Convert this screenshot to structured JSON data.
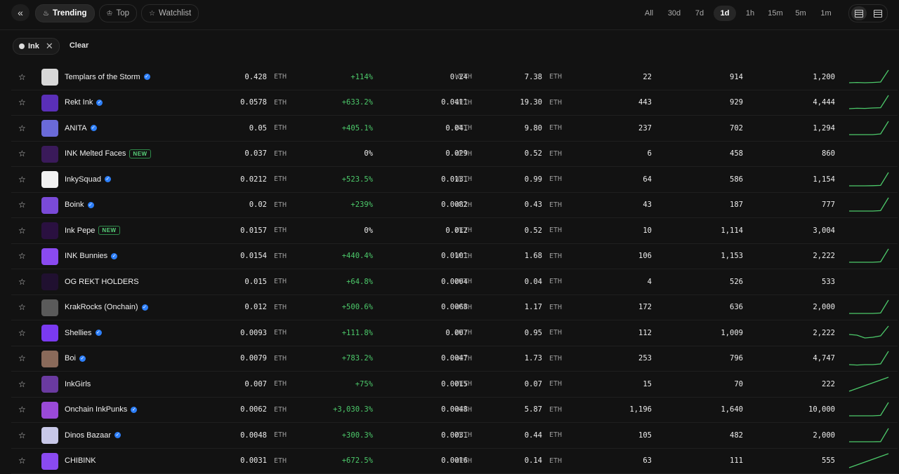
{
  "header": {
    "tabs": [
      {
        "label": "Trending",
        "icon": "flame-icon",
        "active": true
      },
      {
        "label": "Top",
        "icon": "trophy-icon",
        "active": false
      },
      {
        "label": "Watchlist",
        "icon": "star-icon",
        "active": false
      }
    ],
    "ranges": [
      {
        "label": "All",
        "active": false
      },
      {
        "label": "30d",
        "active": false
      },
      {
        "label": "7d",
        "active": false
      },
      {
        "label": "1d",
        "active": true
      },
      {
        "label": "1h",
        "active": false
      },
      {
        "label": "15m",
        "active": false
      },
      {
        "label": "5m",
        "active": false
      },
      {
        "label": "1m",
        "active": false
      }
    ]
  },
  "filters": {
    "chip_label": "Ink",
    "clear_label": "Clear"
  },
  "colors": {
    "positive": "#4cc96a",
    "verified": "#2d7ff9",
    "background": "#121212"
  },
  "rows": [
    {
      "name": "Templars of the Storm",
      "verified": true,
      "new": false,
      "avatar": "#d8d8d8",
      "floor": "0.428",
      "floor_unit": "ETH",
      "change": "+114%",
      "bid": "0.24",
      "bid_unit": "WETH",
      "volume": "7.38",
      "volume_unit": "ETH",
      "sales": "22",
      "owners": "914",
      "supply": "1,200",
      "spark": [
        0.1,
        0.12,
        0.1,
        0.12,
        0.15,
        1.0
      ]
    },
    {
      "name": "Rekt Ink",
      "verified": true,
      "new": false,
      "avatar": "#5a2fb8",
      "floor": "0.0578",
      "floor_unit": "ETH",
      "change": "+633.2%",
      "bid": "0.0411",
      "bid_unit": "WETH",
      "volume": "19.30",
      "volume_unit": "ETH",
      "sales": "443",
      "owners": "929",
      "supply": "4,444",
      "spark": [
        0.05,
        0.08,
        0.07,
        0.1,
        0.12,
        1.0
      ]
    },
    {
      "name": "ANITA",
      "verified": true,
      "new": false,
      "avatar": "#6a6ad8",
      "floor": "0.05",
      "floor_unit": "ETH",
      "change": "+405.1%",
      "bid": "0.041",
      "bid_unit": "WETH",
      "volume": "9.80",
      "volume_unit": "ETH",
      "sales": "237",
      "owners": "702",
      "supply": "1,294",
      "spark": [
        0.05,
        0.05,
        0.05,
        0.05,
        0.1,
        1.0
      ]
    },
    {
      "name": "INK Melted Faces",
      "verified": false,
      "new": true,
      "avatar": "#3a1a5a",
      "floor": "0.037",
      "floor_unit": "ETH",
      "change": "0%",
      "bid": "0.029",
      "bid_unit": "WETH",
      "volume": "0.52",
      "volume_unit": "ETH",
      "sales": "6",
      "owners": "458",
      "supply": "860",
      "spark": []
    },
    {
      "name": "InkySquad",
      "verified": true,
      "new": false,
      "avatar": "#f2f2f2",
      "floor": "0.0212",
      "floor_unit": "ETH",
      "change": "+523.5%",
      "bid": "0.0131",
      "bid_unit": "WETH",
      "volume": "0.99",
      "volume_unit": "ETH",
      "sales": "64",
      "owners": "586",
      "supply": "1,154",
      "spark": [
        0.05,
        0.05,
        0.05,
        0.06,
        0.08,
        1.0
      ]
    },
    {
      "name": "Boink",
      "verified": true,
      "new": false,
      "avatar": "#7a4ad8",
      "floor": "0.02",
      "floor_unit": "ETH",
      "change": "+239%",
      "bid": "0.0082",
      "bid_unit": "WETH",
      "volume": "0.43",
      "volume_unit": "ETH",
      "sales": "43",
      "owners": "187",
      "supply": "777",
      "spark": [
        0.05,
        0.05,
        0.05,
        0.05,
        0.08,
        1.0
      ]
    },
    {
      "name": "Ink Pepe",
      "verified": false,
      "new": true,
      "avatar": "#2a1040",
      "floor": "0.0157",
      "floor_unit": "ETH",
      "change": "0%",
      "bid": "0.012",
      "bid_unit": "WETH",
      "volume": "0.52",
      "volume_unit": "ETH",
      "sales": "10",
      "owners": "1,114",
      "supply": "3,004",
      "spark": []
    },
    {
      "name": "INK Bunnies",
      "verified": true,
      "new": false,
      "avatar": "#8a4af0",
      "floor": "0.0154",
      "floor_unit": "ETH",
      "change": "+440.4%",
      "bid": "0.0101",
      "bid_unit": "WETH",
      "volume": "1.68",
      "volume_unit": "ETH",
      "sales": "106",
      "owners": "1,153",
      "supply": "2,222",
      "spark": [
        0.05,
        0.05,
        0.05,
        0.05,
        0.08,
        1.0
      ]
    },
    {
      "name": "OG REKT HOLDERS",
      "verified": false,
      "new": false,
      "avatar": "#201030",
      "floor": "0.015",
      "floor_unit": "ETH",
      "change": "+64.8%",
      "bid": "0.0004",
      "bid_unit": "WETH",
      "volume": "0.04",
      "volume_unit": "ETH",
      "sales": "4",
      "owners": "526",
      "supply": "533",
      "spark": []
    },
    {
      "name": "KrakRocks (Onchain)",
      "verified": true,
      "new": false,
      "avatar": "#5a5a5a",
      "floor": "0.012",
      "floor_unit": "ETH",
      "change": "+500.6%",
      "bid": "0.0068",
      "bid_unit": "WETH",
      "volume": "1.17",
      "volume_unit": "ETH",
      "sales": "172",
      "owners": "636",
      "supply": "2,000",
      "spark": [
        0.05,
        0.05,
        0.05,
        0.05,
        0.08,
        1.0
      ]
    },
    {
      "name": "Shellies",
      "verified": true,
      "new": false,
      "avatar": "#7a3af0",
      "floor": "0.0093",
      "floor_unit": "ETH",
      "change": "+111.8%",
      "bid": "0.007",
      "bid_unit": "WETH",
      "volume": "0.95",
      "volume_unit": "ETH",
      "sales": "112",
      "owners": "1,009",
      "supply": "2,222",
      "spark": [
        0.4,
        0.35,
        0.15,
        0.2,
        0.3,
        1.0
      ]
    },
    {
      "name": "Boi",
      "verified": true,
      "new": false,
      "avatar": "#8a6a5a",
      "floor": "0.0079",
      "floor_unit": "ETH",
      "change": "+783.2%",
      "bid": "0.0047",
      "bid_unit": "WETH",
      "volume": "1.73",
      "volume_unit": "ETH",
      "sales": "253",
      "owners": "796",
      "supply": "4,747",
      "spark": [
        0.05,
        0.02,
        0.05,
        0.05,
        0.1,
        1.0
      ]
    },
    {
      "name": "InkGirls",
      "verified": false,
      "new": false,
      "avatar": "#6a3aa0",
      "floor": "0.007",
      "floor_unit": "ETH",
      "change": "+75%",
      "bid": "0.0015",
      "bid_unit": "WETH",
      "volume": "0.07",
      "volume_unit": "ETH",
      "sales": "15",
      "owners": "70",
      "supply": "222",
      "spark": [
        0.0,
        0.2,
        0.4,
        0.6,
        0.8,
        1.0
      ]
    },
    {
      "name": "Onchain InkPunks",
      "verified": true,
      "new": false,
      "avatar": "#9a4ad8",
      "floor": "0.0062",
      "floor_unit": "ETH",
      "change": "+3,030.3%",
      "bid": "0.0048",
      "bid_unit": "WETH",
      "volume": "5.87",
      "volume_unit": "ETH",
      "sales": "1,196",
      "owners": "1,640",
      "supply": "10,000",
      "spark": [
        0.05,
        0.05,
        0.05,
        0.05,
        0.08,
        1.0
      ]
    },
    {
      "name": "Dinos Bazaar",
      "verified": true,
      "new": false,
      "avatar": "#c8c8e8",
      "floor": "0.0048",
      "floor_unit": "ETH",
      "change": "+300.3%",
      "bid": "0.0031",
      "bid_unit": "WETH",
      "volume": "0.44",
      "volume_unit": "ETH",
      "sales": "105",
      "owners": "482",
      "supply": "2,000",
      "spark": [
        0.05,
        0.05,
        0.05,
        0.05,
        0.06,
        1.0
      ]
    },
    {
      "name": "CHIBINK",
      "verified": false,
      "new": false,
      "avatar": "#8a4af0",
      "floor": "0.0031",
      "floor_unit": "ETH",
      "change": "+672.5%",
      "bid": "0.0016",
      "bid_unit": "WETH",
      "volume": "0.14",
      "volume_unit": "ETH",
      "sales": "63",
      "owners": "111",
      "supply": "555",
      "spark": [
        0.0,
        0.2,
        0.4,
        0.6,
        0.8,
        1.0
      ]
    }
  ]
}
